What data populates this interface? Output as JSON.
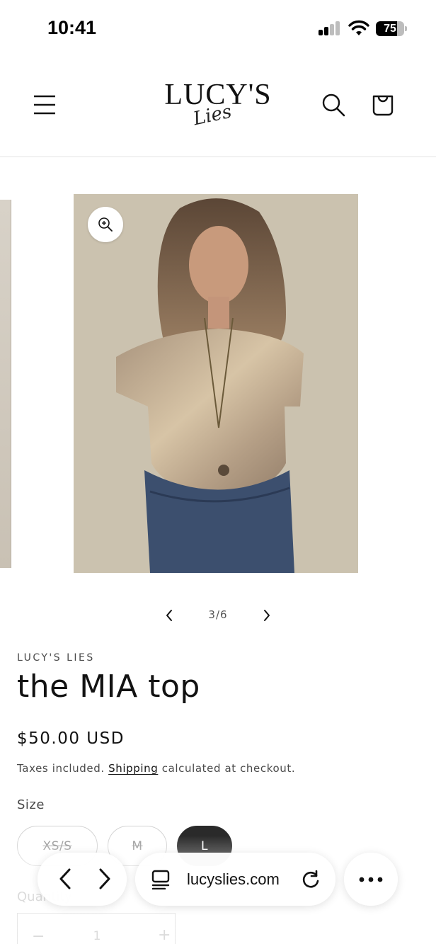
{
  "status_bar": {
    "time": "10:41",
    "battery": "75",
    "battery_level": 0.75
  },
  "header": {
    "logo_main": "LUCY'S",
    "logo_sub": "Lies",
    "icons": [
      "menu-icon",
      "search-icon",
      "cart-icon"
    ]
  },
  "gallery": {
    "current": "3",
    "separator": "/",
    "total": "6",
    "zoom_icon": "zoom-in-icon"
  },
  "product": {
    "vendor": "LUCY'S LIES",
    "title": "the MIA top",
    "price": "$50.00 USD",
    "tax_prefix": "Taxes included. ",
    "shipping_link": "Shipping",
    "tax_suffix": " calculated at checkout.",
    "size_label": "Size",
    "sizes": [
      {
        "label": "XS/S",
        "available": false,
        "selected": false
      },
      {
        "label": "M",
        "available": false,
        "selected": false
      },
      {
        "label": "L",
        "available": true,
        "selected": true
      }
    ],
    "quantity_label": "Quantity",
    "quantity_value": "1",
    "quantity_minus": "−",
    "quantity_plus": "+"
  },
  "browser": {
    "url": "lucyslies.com",
    "icons": [
      "back-icon",
      "forward-icon",
      "tabs-icon",
      "reload-icon",
      "more-icon"
    ]
  },
  "colors": {
    "text": "#121212",
    "muted": "#4a4a4a",
    "selected_pill": "#2a2a2a",
    "border": "#d2d2d2"
  }
}
